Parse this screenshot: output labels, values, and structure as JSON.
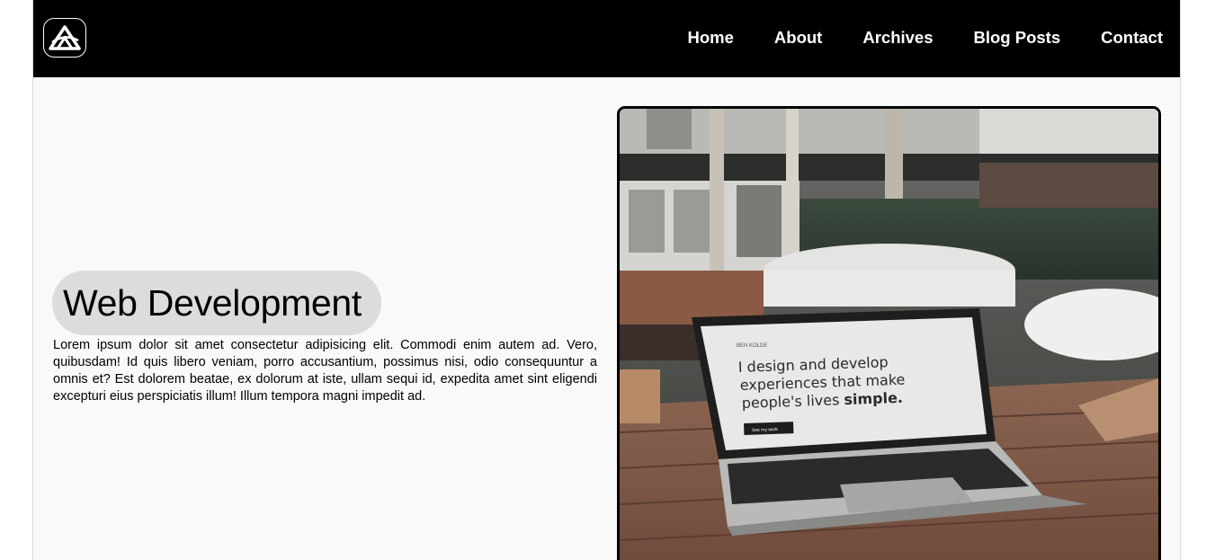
{
  "brand": {
    "logo_icon": "mountain-a-logo-icon"
  },
  "nav": {
    "items": [
      {
        "label": "Home"
      },
      {
        "label": "About"
      },
      {
        "label": "Archives"
      },
      {
        "label": "Blog Posts"
      },
      {
        "label": "Contact"
      }
    ]
  },
  "hero": {
    "title": "Web Development",
    "body": "Lorem ipsum dolor sit amet consectetur adipisicing elit. Commodi enim autem ad. Vero, quibusdam! Id quis libero veniam, porro accusantium, possimus nisi, odio consequuntur a omnis et? Est dolorem beatae, ex dolorum at iste, ullam sequi id, expedita amet sint eligendi excepturi eius perspiciatis illum! Illum tempora magni impedit ad.",
    "image": {
      "screen_brand": "BEN KOLDE",
      "screen_line1": "I design and develop",
      "screen_line2": "experiences that make",
      "screen_line3_plain": "people's lives ",
      "screen_line3_bold": "simple.",
      "screen_button": "See my work"
    }
  },
  "colors": {
    "navbar": "#000000",
    "page_bg": "#f9f9f9",
    "pill_bg": "#dcdcdc",
    "nav_text": "#ffffff"
  }
}
